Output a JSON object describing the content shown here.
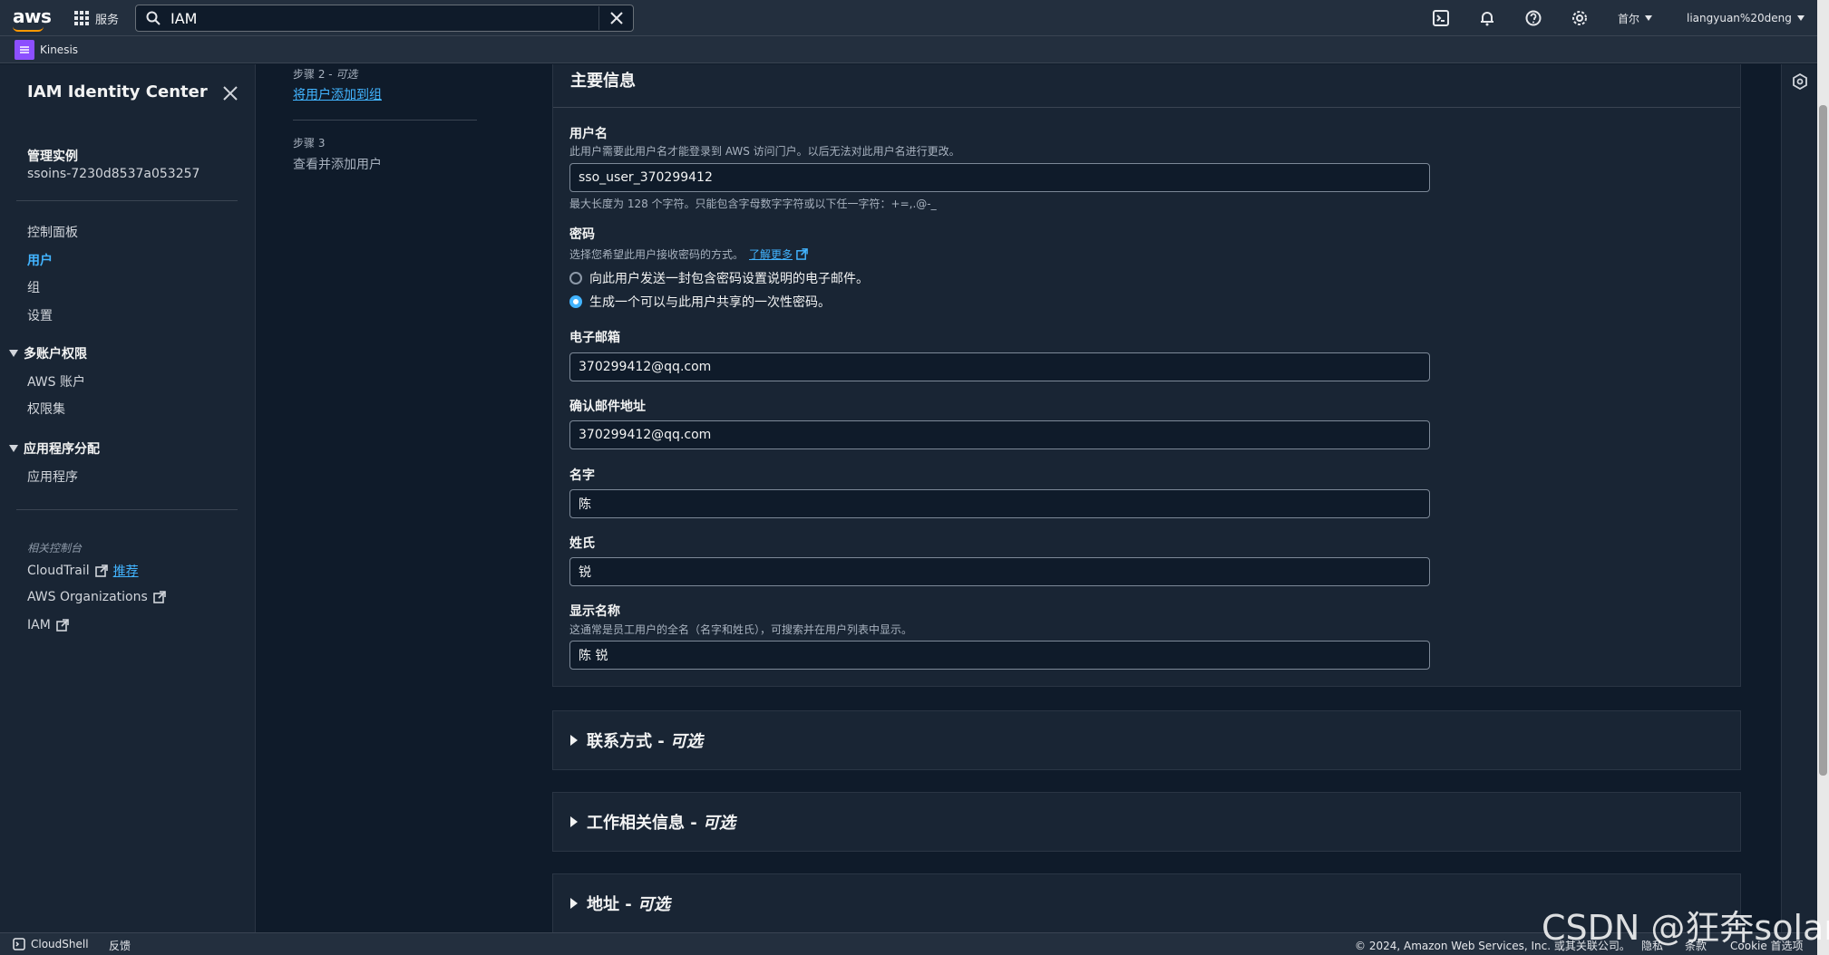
{
  "topnav": {
    "logo_text": "aws",
    "services_label": "服务",
    "search_value": "IAM",
    "region_label": "首尔",
    "account_label": "liangyuan%20deng"
  },
  "favorites": {
    "kinesis_label": "Kinesis"
  },
  "sidebar": {
    "title": "IAM Identity Center",
    "instance_label": "管理实例",
    "instance_id": "ssoins-7230d8537a053257",
    "nav": {
      "dashboard": "控制面板",
      "users": "用户",
      "groups": "组",
      "settings": "设置"
    },
    "section_multi_account": "多账户权限",
    "aws_accounts": "AWS 账户",
    "permission_sets": "权限集",
    "section_app_assignment": "应用程序分配",
    "applications": "应用程序",
    "related_consoles": "相关控制台",
    "cloudtrail": "CloudTrail",
    "recommended": "推荐",
    "organizations": "AWS Organizations",
    "iam": "IAM"
  },
  "steps": {
    "step2_prefix": "步骤 2 - ",
    "step2_optional": "可选",
    "step2_link": "将用户添加到组",
    "step3_label": "步骤 3",
    "step3_title": "查看并添加用户"
  },
  "form": {
    "section_title": "主要信息",
    "username_label": "用户名",
    "username_desc": "此用户需要此用户名才能登录到 AWS 访问门户。以后无法对此用户名进行更改。",
    "username_value": "sso_user_370299412",
    "username_hint": "最大长度为 128 个字符。只能包含字母数字字符或以下任一字符：+=,.@-_",
    "password_label": "密码",
    "password_desc": "选择您希望此用户接收密码的方式。",
    "learn_more": "了解更多",
    "radio_email": "向此用户发送一封包含密码设置说明的电子邮件。",
    "radio_otp": "生成一个可以与此用户共享的一次性密码。",
    "email_label": "电子邮箱",
    "email_value": "370299412@qq.com",
    "confirm_email_label": "确认邮件地址",
    "confirm_email_value": "370299412@qq.com",
    "first_name_label": "名字",
    "first_name_value": "陈",
    "last_name_label": "姓氏",
    "last_name_value": "锐",
    "display_name_label": "显示名称",
    "display_name_desc": "这通常是员工用户的全名（名字和姓氏），可搜索并在用户列表中显示。",
    "display_name_value": "陈 锐"
  },
  "expanders": {
    "contact_title": "联系方式 - ",
    "job_title": "工作相关信息 - ",
    "address_title": "地址 - ",
    "optional": "可选"
  },
  "footer": {
    "cloudshell": "CloudShell",
    "feedback": "反馈",
    "copyright": "© 2024, Amazon Web Services, Inc. 或其关联公司。",
    "privacy": "隐私",
    "terms": "条款",
    "cookie": "Cookie 首选项"
  },
  "watermark": "CSDN @狂奔solar",
  "colors": {
    "accent": "#42b4ff",
    "nav_bg": "#232f3e",
    "page_bg": "#0f1b2a",
    "panel_bg": "#192534",
    "aws_orange": "#ff9900"
  }
}
